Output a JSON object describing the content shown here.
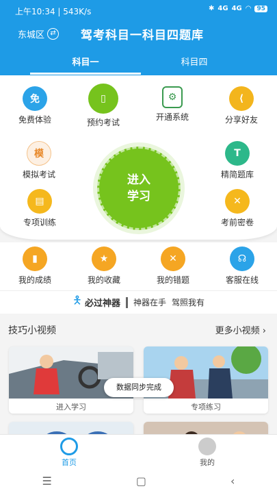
{
  "status_bar": {
    "time_speed": "上午10:34 | 543K/s",
    "battery": "95",
    "signal_a": "4G",
    "signal_b": "4G"
  },
  "header": {
    "district": "东城区",
    "title": "驾考科目一科目四题库"
  },
  "tabs": [
    {
      "label": "科目一",
      "active": true
    },
    {
      "label": "科目四",
      "active": false
    }
  ],
  "main_grid": {
    "free_trial": "免费体验",
    "book_exam": "预约考试",
    "open_system": "开通系统",
    "share": "分享好友",
    "mock_exam": "模拟考试",
    "simplified_bank": "精简题库",
    "special_training": "专项训练",
    "pre_exam_secrets": "考前密卷",
    "enter_line1": "进入",
    "enter_line2": "学习",
    "free_glyph": "免",
    "mock_glyph": "模",
    "simple_glyph": "T"
  },
  "row2": {
    "my_scores": "我的成绩",
    "my_favorites": "我的收藏",
    "my_mistakes": "我的错题",
    "customer_service": "客服在线"
  },
  "slogan": {
    "main": "必过神器",
    "sub1": "神器在手",
    "sub2": "驾照我有"
  },
  "video_section": {
    "title": "技巧小视频",
    "more": "更多小视频",
    "cards": [
      {
        "caption": "进入学习"
      },
      {
        "caption": "专项练习"
      }
    ]
  },
  "toast": "数据同步完成",
  "bottom_nav": [
    {
      "label": "首页",
      "active": true
    },
    {
      "label": "我的",
      "active": false
    }
  ],
  "colors": {
    "brand": "#1e9be6",
    "green": "#76c31d",
    "orange": "#f5a623"
  },
  "icons": [
    "free-trial-icon",
    "tablet-icon",
    "settings-doc-icon",
    "share-icon",
    "mock-icon",
    "text-icon",
    "clipboard-icon",
    "close-icon",
    "bar-chart-icon",
    "star-icon",
    "x-icon",
    "headset-icon",
    "steering-wheel-icon",
    "user-icon"
  ]
}
